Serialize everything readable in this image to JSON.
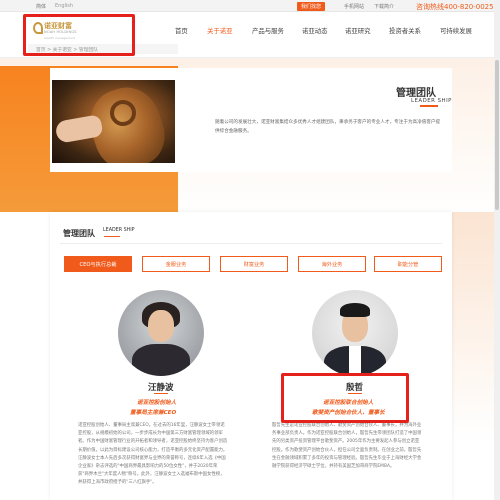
{
  "topbar": {
    "lang_cn": "简体",
    "lang_en": "English",
    "contact_button": "我们找您",
    "mobile_site": "手机网站",
    "brochure": "下载简介",
    "hotline": "咨询热线400-820-0025"
  },
  "logo": {
    "cn": "诺亚财富",
    "en": "NOAH HOLDINGS",
    "sub": "wealth management"
  },
  "nav": {
    "items": [
      "首页",
      "关于诺亚",
      "产品与服务",
      "诺亚动态",
      "诺亚研究",
      "投资者关系",
      "可持续发展"
    ],
    "active_index": 1
  },
  "breadcrumb": "首页 > 关于诺亚 > 管理团队",
  "banner": {
    "title": "管理团队",
    "subtitle": "LEADER SHIP",
    "description": "随着公司的发展壮大，诺亚财富集结众多优秀人才组建团队，秉承务于客户的专业人才，专注于为高净值客户提供综合金融服务。"
  },
  "team_section": {
    "heading": "管理团队",
    "heading_en": "LEADER SHIP",
    "tabs": [
      "CEO与执行总裁",
      "金服业务",
      "财富业务",
      "海外业务",
      "职能分管"
    ],
    "active_tab": 0
  },
  "profiles": [
    {
      "name": "汪静波",
      "role_line1": "诺亚控股创始人",
      "role_line2": "董事局主席兼CEO",
      "bio": "诺亚控股创始人、董事局主席兼CEO。在过去的16年里，汪静波女士带领诺亚控股，从规模初始的公司，一步步成长为中国第三方财富管理领域的领军者。作为中国财富管理行业的开拓者和领导者，诺亚控股始终坚持为客户创造长期价值。以此为目标建设公司核心能力，打造平衡的多元化资产配置能力。\n\n汪静波女士本人先后多次获得财富界与业界的荣誉称号，连续6年入选《中国企业家》杂志评选的\"中国商界最具影响力的50位女性\"，并于2020年荣获\"商界木兰\"大年度人物\"称号。此外，汪静波女士入选福布斯中国女性榜，并获得上海市政府授予的\"三八红旗手\"。"
    },
    {
      "name": "殷哲",
      "role_line1": "诺亚控股联合创始人",
      "role_line2": "歌斐资产创始合伙人、董事长",
      "bio": "殷哲先生是诺亚控股联合创始人、歌斐资产创始合伙人、董事长，并为海外业务事业部负责人。作为诺亚控股联合创始人，殷哲先生带领团队打造了中国领先的另类资产投资管理平台歌斐资产。2005年作为主要发起人参与创立诺亚控股。作为歌斐资产创始合伙人，担任公司全面负责制。在创业之前，殷哲先生在金融领域积累了多年的投资与管理经验。殷哲先生毕业于上海财经大学金融学院获得经济学硕士学位，并持有美国芝加哥商学院EMBA。"
    }
  ],
  "colors": {
    "accent": "#f05a1a",
    "highlight_box": "#e6201a",
    "logo_gold": "#c8973e"
  }
}
